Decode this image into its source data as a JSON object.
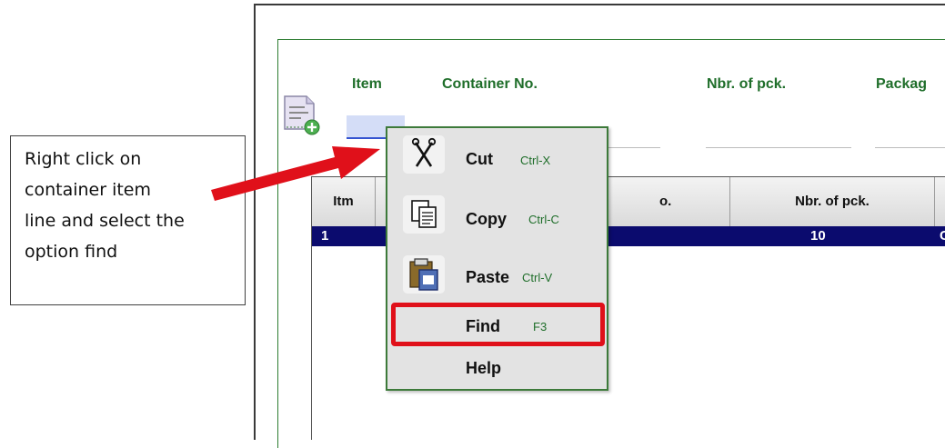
{
  "callout": {
    "lines": [
      "Right click on",
      "container item",
      "line and select the",
      "option find"
    ]
  },
  "form": {
    "labels": {
      "item": "Item",
      "container_no": "Container No.",
      "nbr_pck": "Nbr. of pck.",
      "package": "Packag"
    },
    "add_icon": "document-add-icon"
  },
  "table": {
    "headers": [
      "Itm",
      "o.",
      "Nbr. of pck.",
      ""
    ],
    "row": {
      "itm": "1",
      "nbr_pck": "10",
      "tail": "C"
    }
  },
  "context_menu": {
    "items": [
      {
        "label": "Cut",
        "shortcut": "Ctrl-X",
        "icon": "scissors-icon"
      },
      {
        "label": "Copy",
        "shortcut": "Ctrl-C",
        "icon": "copy-icon"
      },
      {
        "label": "Paste",
        "shortcut": "Ctrl-V",
        "icon": "paste-icon"
      },
      {
        "label": "Find",
        "shortcut": "F3",
        "highlighted": true
      },
      {
        "label": "Help",
        "shortcut": ""
      }
    ]
  },
  "colors": {
    "highlight_border": "#e0101a",
    "arrow": "#e0101a",
    "selected_row": "#0b0b6e",
    "label_green": "#1f6e2a"
  }
}
